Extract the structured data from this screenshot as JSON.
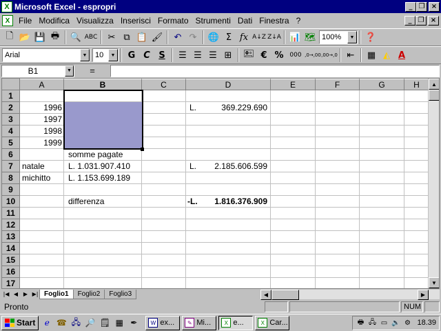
{
  "window": {
    "title": "Microsoft Excel - espropri",
    "minimize": "_",
    "maximize": "□",
    "close": "×"
  },
  "menubar": {
    "items": [
      "File",
      "Modifica",
      "Visualizza",
      "Inserisci",
      "Formato",
      "Strumenti",
      "Dati",
      "Finestra",
      "?"
    ]
  },
  "toolbar_standard": {
    "zoom": "100%"
  },
  "toolbar_format": {
    "font": "Arial",
    "size": "10",
    "bold_label": "G",
    "italic_label": "C",
    "underline_label": "S",
    "currency_label": "€",
    "percent_label": "%",
    "thousands_label": "000",
    "inc_decimals_label": ",0→,00",
    "dec_decimals_label": ",00→,0"
  },
  "formulabar": {
    "name_box": "B1",
    "equals": "=",
    "content": ""
  },
  "sheet": {
    "columns": [
      "A",
      "B",
      "C",
      "D",
      "E",
      "F",
      "G",
      "H"
    ],
    "selected_column": "B",
    "rows": [
      "1",
      "2",
      "3",
      "4",
      "5",
      "6",
      "7",
      "8",
      "9",
      "10",
      "11",
      "12",
      "13",
      "14",
      "15",
      "16",
      "17"
    ],
    "cells": {
      "A2": "1996",
      "A3": "1997",
      "A4": "1998",
      "A5": "1999",
      "B6": "somme pagate",
      "A7": "natale",
      "B7": "L.  1.031.907.410",
      "A8": "michitto",
      "B8": "L.  1.153.699.189",
      "B10": "differenza",
      "D2_prefix": "L.",
      "D2_value": "369.229.690",
      "D7_prefix": "L.",
      "D7_value": "2.185.606.599",
      "D10_prefix": "-L.",
      "D10_value": "1.816.376.909"
    },
    "selection_color": "#9999cc"
  },
  "tabs": {
    "sheets": [
      "Foglio1",
      "Foglio2",
      "Foglio3"
    ],
    "active": "Foglio1"
  },
  "statusbar": {
    "text": "Pronto",
    "num": "NUM"
  },
  "taskbar": {
    "start": "Start",
    "buttons": [
      "ex...",
      "Mi...",
      "e...",
      "Car..."
    ],
    "active_button": "e...",
    "clock": "18.39"
  }
}
